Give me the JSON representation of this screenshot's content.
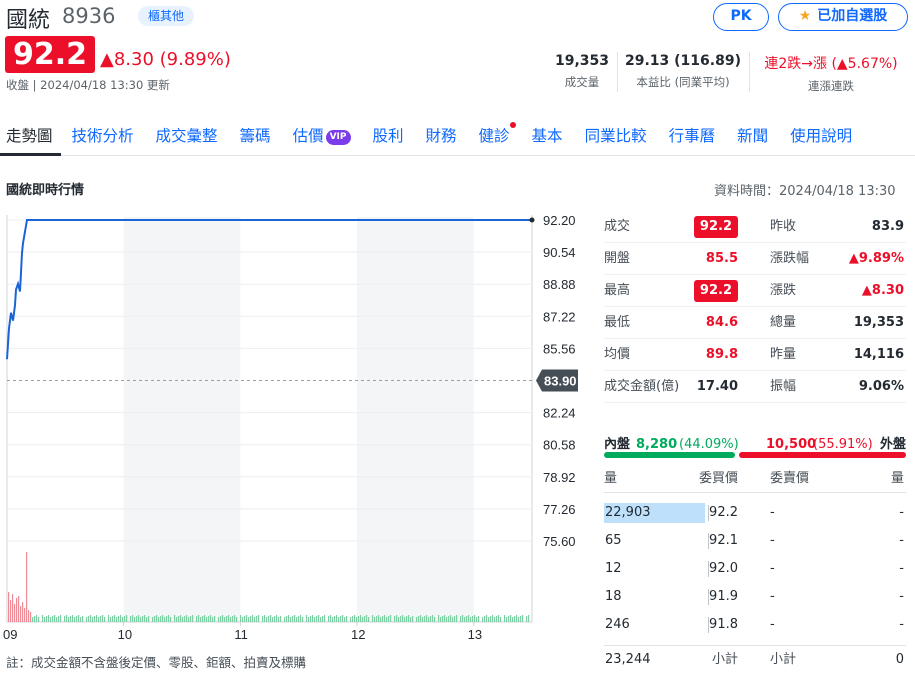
{
  "header": {
    "name": "國統",
    "code": "8936",
    "market_tag": "櫃其他",
    "pk_label": "PK",
    "watch_label": "已加自選股",
    "price": "92.2",
    "change": "▲8.30 (9.89%)",
    "status": "收盤 | 2024/04/18 13:30 更新"
  },
  "stats": {
    "volume_value": "19,353",
    "volume_label": "成交量",
    "pe_value": "29.13 (116.89)",
    "pe_label": "本益比 (同業平均)",
    "streak_value": "連2跌→漲 (▲5.67%)",
    "streak_label": "連漲連跌"
  },
  "tabs": [
    "走勢圖",
    "技術分析",
    "成交彙整",
    "籌碼",
    "估價",
    "股利",
    "財務",
    "健診",
    "基本",
    "同業比較",
    "行事曆",
    "新聞",
    "使用說明"
  ],
  "vip_label": "VIP",
  "section_title": "國統即時行情",
  "data_time": "資料時間：2024/04/18 13:30",
  "chart_data": {
    "type": "line",
    "y_ticks": [
      "92.20",
      "90.54",
      "88.88",
      "87.22",
      "85.56",
      "83.90",
      "82.24",
      "80.58",
      "78.92",
      "77.26",
      "75.60"
    ],
    "ylim": [
      75.6,
      92.2
    ],
    "prev_close": 83.9,
    "prev_close_label": "83.90",
    "x_ticks": [
      "09",
      "10",
      "11",
      "12",
      "13"
    ],
    "series": [
      {
        "values": [
          85.0,
          86.6,
          87.4,
          87.0,
          87.8,
          88.6,
          88.9,
          88.5,
          90.5,
          91.0,
          92.2,
          92.2,
          92.2,
          92.2,
          92.2,
          92.2,
          92.2,
          92.2,
          92.2,
          92.2
        ]
      }
    ]
  },
  "quote": {
    "rows": [
      {
        "l1": "成交",
        "v1": "92.2",
        "l2": "昨收",
        "v2": "83.9"
      },
      {
        "l1": "開盤",
        "v1": "85.5",
        "l2": "漲跌幅",
        "v2": "▲9.89%"
      },
      {
        "l1": "最高",
        "v1": "92.2",
        "l2": "漲跌",
        "v2": "▲8.30"
      },
      {
        "l1": "最低",
        "v1": "84.6",
        "l2": "總量",
        "v2": "19,353"
      },
      {
        "l1": "均價",
        "v1": "89.8",
        "l2": "昨量",
        "v2": "14,116"
      },
      {
        "l1": "成交金額(億)",
        "v1": "17.40",
        "l2": "振幅",
        "v2": "9.06%"
      }
    ]
  },
  "inner_outer": {
    "inner_label": "內盤",
    "inner_value": "8,280",
    "inner_pct": "(44.09%)",
    "outer_value": "10,500",
    "outer_pct": "(55.91%)",
    "outer_label": "外盤",
    "inner_fraction": 0.4409
  },
  "orderbook": {
    "headers": {
      "qty": "量",
      "bid": "委買價",
      "ask": "委賣價",
      "ask_qty": "量"
    },
    "rows": [
      {
        "qty": "22,903",
        "bid": "92.2",
        "ask": "-",
        "ask_qty": "-"
      },
      {
        "qty": "65",
        "bid": "92.1",
        "ask": "-",
        "ask_qty": "-"
      },
      {
        "qty": "12",
        "bid": "92.0",
        "ask": "-",
        "ask_qty": "-"
      },
      {
        "qty": "18",
        "bid": "91.9",
        "ask": "-",
        "ask_qty": "-"
      },
      {
        "qty": "246",
        "bid": "91.8",
        "ask": "-",
        "ask_qty": "-"
      }
    ],
    "total_bid_qty": "23,244",
    "total_bid_label": "小計",
    "total_ask_label": "小計",
    "total_ask_qty": "0"
  },
  "footnote": "註：成交金額不含盤後定價、零股、鉅額、拍賣及標購"
}
